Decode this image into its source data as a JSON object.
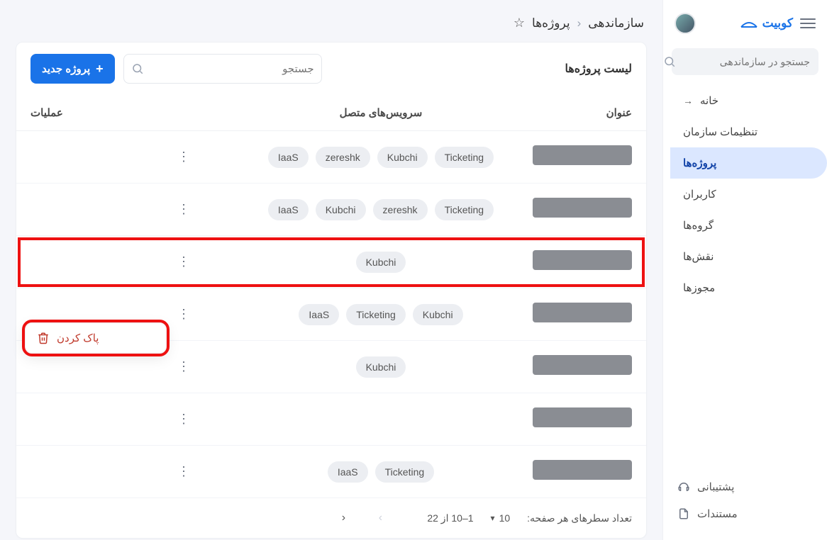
{
  "brand": "کوبیت",
  "sidebar": {
    "search_placeholder": "جستجو در سازماندهی",
    "home": "خانه",
    "items": [
      {
        "label": "تنظیمات سازمان"
      },
      {
        "label": "پروژه‌ها"
      },
      {
        "label": "کاربران"
      },
      {
        "label": "گروه‌ها"
      },
      {
        "label": "نقش‌ها"
      },
      {
        "label": "مجوزها"
      }
    ],
    "support": "پشتیبانی",
    "docs": "مستندات"
  },
  "breadcrumb": {
    "org": "سازماندهی",
    "page": "پروژه‌ها"
  },
  "panel": {
    "title": "لیست پروژه‌ها",
    "search_placeholder": "جستجو",
    "new_button": "پروژه جدید"
  },
  "columns": {
    "title": "عنوان",
    "services": "سرویس‌های متصل",
    "ops": "عملیات"
  },
  "rows": [
    {
      "services": [
        "IaaS",
        "zereshk",
        "Kubchi",
        "Ticketing"
      ]
    },
    {
      "services": [
        "IaaS",
        "Kubchi",
        "zereshk",
        "Ticketing"
      ]
    },
    {
      "services": [
        "Kubchi"
      ],
      "highlight": true
    },
    {
      "services": [
        "IaaS",
        "Ticketing",
        "Kubchi"
      ]
    },
    {
      "services": [
        "Kubchi"
      ]
    },
    {
      "services": []
    },
    {
      "services": [
        "IaaS",
        "Ticketing"
      ]
    }
  ],
  "context_menu": {
    "delete": "پاک کردن"
  },
  "pager": {
    "rows_label": "تعداد سطرهای هر صفحه:",
    "rows_value": "10",
    "range": "1–10 از 22"
  }
}
